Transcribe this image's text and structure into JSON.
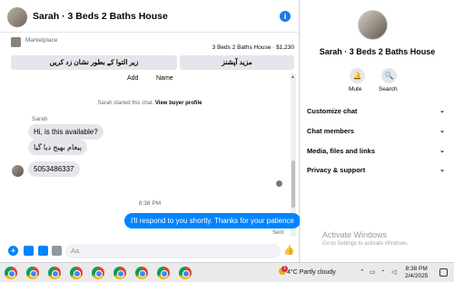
{
  "header": {
    "title": "Sarah · 3 Beds 2 Baths House",
    "info_icon": "info-icon"
  },
  "marketplace": {
    "label": "Marketplace",
    "listing_price": "3 Beds 2 Baths House · $1,230",
    "button_left": "زیر التوا کے بطور نشان زد کریں",
    "button_right": "مزید آپشنز"
  },
  "tabs": [
    "Add",
    "Name"
  ],
  "conversation": {
    "started_prefix": "Sarah started this chat. ",
    "started_link": "View buyer profile",
    "sender": "Sarah",
    "incoming": [
      "Hi, is this available?",
      "پیغام بھیج دیا گیا",
      "5053486337"
    ],
    "timestamp": "8:38 PM",
    "outgoing": "I'll respond to you shortly. Thanks for your patience",
    "status": "Sent"
  },
  "composer": {
    "placeholder": "Aa"
  },
  "profile": {
    "name": "Sarah · 3 Beds 2 Baths House",
    "actions": [
      {
        "label": "Mute",
        "icon": "bell-icon"
      },
      {
        "label": "Search",
        "icon": "search-icon"
      }
    ],
    "sections": [
      "Customize chat",
      "Chat members",
      "Media, files and links",
      "Privacy & support"
    ]
  },
  "watermark": {
    "title": "Activate Windows",
    "subtitle": "Go to Settings to activate Windows."
  },
  "taskbar": {
    "app_count": 9,
    "weather_badge": "1",
    "weather": "4°C  Partly cloudy",
    "time": "8:38 PM",
    "date": "2/4/2025"
  },
  "colors": {
    "accent": "#0084ff",
    "messenger_blue": "#1877f2",
    "bubble_gray": "#e4e6eb"
  }
}
